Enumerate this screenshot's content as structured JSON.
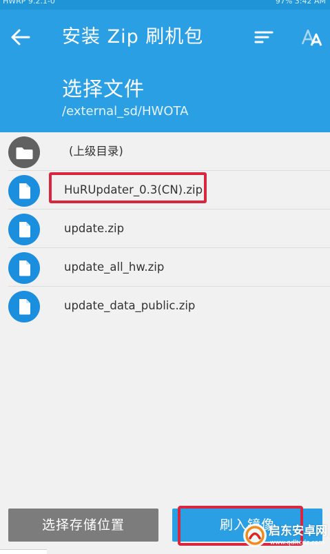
{
  "status_bar": {
    "left_text": "HWRP 9.2.1-0",
    "right_text": "97% 3:42 AM"
  },
  "header": {
    "title": "安装 Zip 刷机包",
    "section_title": "选择文件",
    "path": "/external_sd/HWOTA",
    "background_color": "#2a9fe3",
    "icons": {
      "back": "arrow-left-icon",
      "sort": "sort-icon",
      "font": "font-size-icon"
    }
  },
  "file_list": {
    "parent": {
      "label": "(上级目录)",
      "icon": "folder-icon"
    },
    "files": [
      {
        "name": "HuRUpdater_0.3(CN).zip",
        "icon": "file-icon",
        "highlighted": true
      },
      {
        "name": "update.zip",
        "icon": "file-icon",
        "highlighted": false
      },
      {
        "name": "update_all_hw.zip",
        "icon": "file-icon",
        "highlighted": false
      },
      {
        "name": "update_data_public.zip",
        "icon": "file-icon",
        "highlighted": false
      }
    ]
  },
  "buttons": {
    "select_storage": "选择存储位置",
    "flash": "刷入镜像"
  },
  "watermark": {
    "main": "启东安卓网",
    "sub": "www.qdltcdz.com"
  },
  "colors": {
    "accent": "#2a9fe3",
    "file_icon": "#1b8ede",
    "folder_icon": "#616161",
    "highlight": "#d7263d",
    "secondary_button": "#7c7c7c"
  }
}
